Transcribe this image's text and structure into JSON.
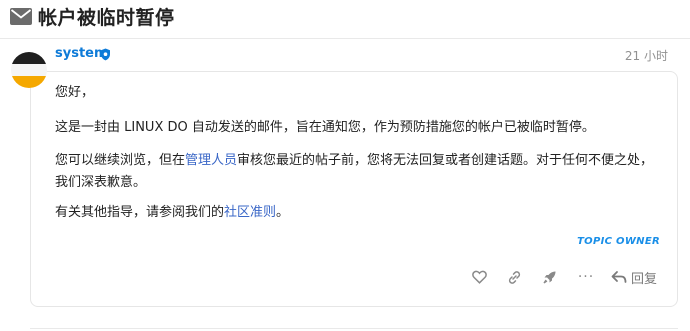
{
  "topic": {
    "title": "帐户被临时暂停",
    "icon": "envelope-icon"
  },
  "post": {
    "username": "system",
    "badge_icon": "shield-icon",
    "date": "21 小时",
    "greeting": "您好，",
    "paragraph2": "这是一封由 LINUX DO 自动发送的邮件，旨在通知您，作为预防措施您的帐户已被临时暂停。",
    "paragraph3_before": "您可以继续浏览，但在",
    "paragraph3_link": "管理人员",
    "paragraph3_after": "审核您最近的帖子前，您将无法回复或者创建话题。对于任何不便之处，我们深表歉意。",
    "paragraph4_before": "有关其他指导，请参阅我们的",
    "paragraph4_link": "社区准则",
    "paragraph4_after": "。",
    "topic_owner_label": "TOPIC OWNER"
  },
  "actions": {
    "like_icon": "heart-icon",
    "link_icon": "link-icon",
    "boost_icon": "rocket-icon",
    "reply_icon": "reply-icon",
    "reply_label": "回复"
  },
  "colors": {
    "username": "#0e7bd8",
    "link": "#3a67c7",
    "topic_owner": "#1a8fe8",
    "avatar_top": "#1f1f1f",
    "avatar_middle": "#f5f5f5",
    "avatar_bottom": "#f5a800"
  }
}
